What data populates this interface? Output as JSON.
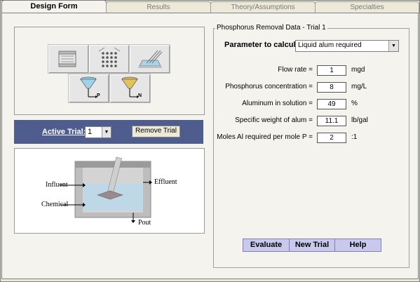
{
  "tabs": [
    {
      "label": "Design Form",
      "active": true
    },
    {
      "label": "Results",
      "active": false
    },
    {
      "label": "Theory/Assumptions",
      "active": false
    },
    {
      "label": "Specialties",
      "active": false
    }
  ],
  "tool_icons": [
    "rectangular-basin-icon",
    "tube-settler-icon",
    "inclined-settler-icon",
    "phosphorus-funnel-icon",
    "nitrogen-funnel-icon"
  ],
  "icon_labels": {
    "p": "P",
    "n": "N"
  },
  "trial": {
    "label": "Active Trial:",
    "selected": "1",
    "remove_label": "Remove Trial"
  },
  "diagram": {
    "influent": "Influent",
    "effluent": "Effluent",
    "chemical": "Chemical",
    "pout": "Pout"
  },
  "panel": {
    "legend": "Phosphorus Removal Data - Trial 1",
    "param_label": "Parameter to calculate:",
    "param_value": "Liquid alum required",
    "fields": [
      {
        "label": "Flow rate =",
        "value": "1",
        "unit": "mgd"
      },
      {
        "label": "Phosphorus concentration =",
        "value": "8",
        "unit": "mg/L"
      },
      {
        "label": "Aluminum in solution =",
        "value": "49",
        "unit": "%"
      },
      {
        "label": "Specific weight of alum =",
        "value": "11.1",
        "unit": "lb/gal"
      },
      {
        "label": "Moles Al required per mole P =",
        "value": "2",
        "unit": ":1"
      }
    ]
  },
  "actions": {
    "evaluate": "Evaluate",
    "new_trial": "New Trial",
    "help": "Help"
  },
  "colors": {
    "trial_bar": "#4e5d8e",
    "action_button": "#c9c9ee",
    "background": "#f4f3ee"
  }
}
